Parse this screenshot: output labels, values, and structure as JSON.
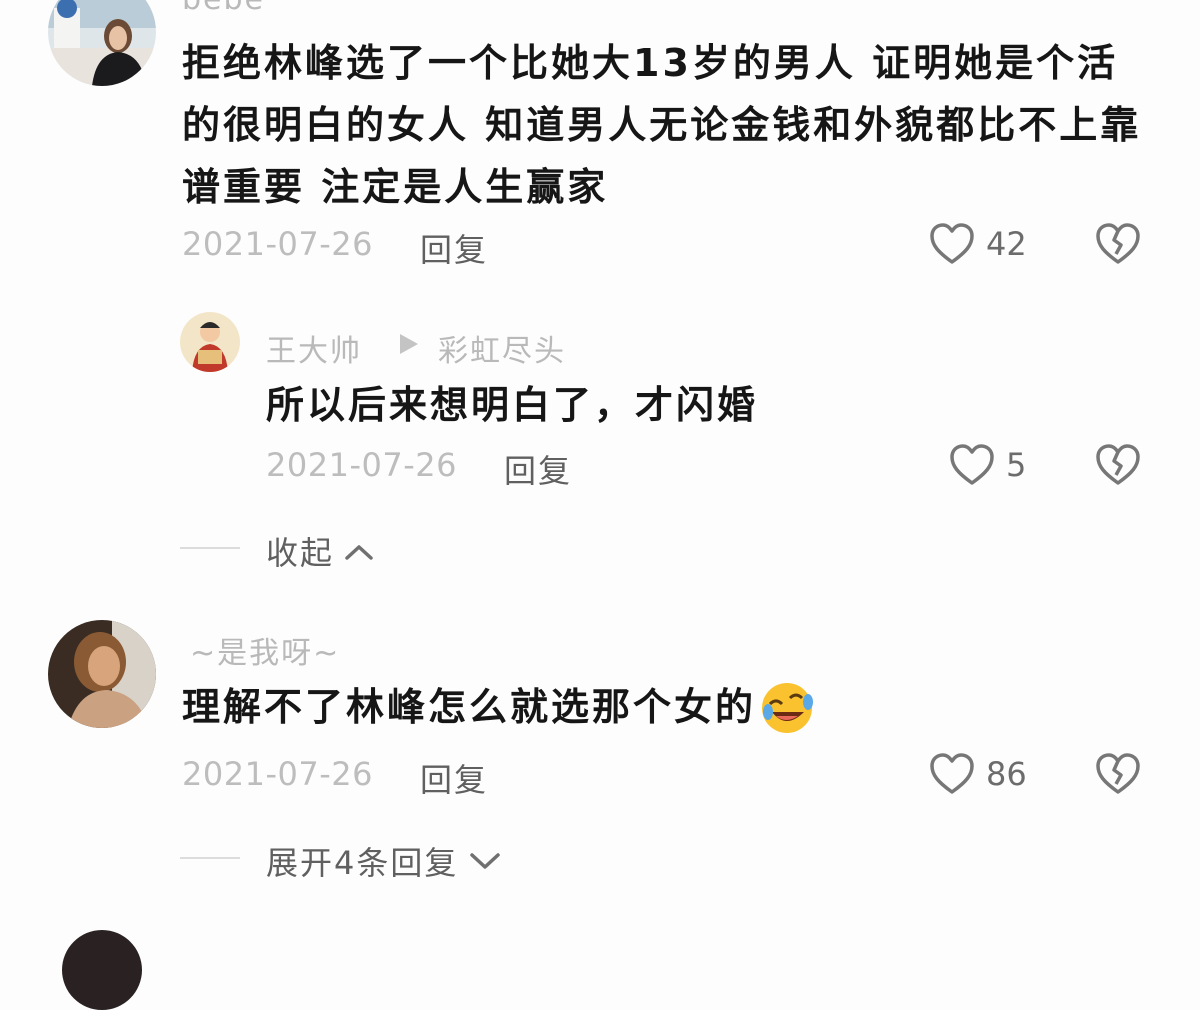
{
  "comments": [
    {
      "username": "bebe",
      "text": "拒绝林峰选了一个比她大13岁的男人 证明她是个活的很明白的女人 知道男人无论金钱和外貌都比不上靠谱重要 注定是人生赢家",
      "date": "2021-07-26",
      "reply_label": "回复",
      "likes": "42",
      "reply": {
        "username": "王大帅",
        "reply_to": "彩虹尽头",
        "text": "所以后来想明白了，才闪婚",
        "date": "2021-07-26",
        "reply_label": "回复",
        "likes": "5"
      },
      "collapse_label": "收起"
    },
    {
      "username": "~是我呀~",
      "text": "理解不了林峰怎么就选那个女的",
      "emoji": "rolling-on-floor-laughing-emoji",
      "date": "2021-07-26",
      "reply_label": "回复",
      "likes": "86",
      "expand_label": "展开4条回复"
    }
  ],
  "colors": {
    "background": "#fdfdfd",
    "username": "#b9b9b9",
    "text": "#161616",
    "meta": "#bdbdbd",
    "action": "#606060"
  },
  "icons": [
    "heart-outline-icon",
    "broken-heart-icon",
    "chevron-up-icon",
    "chevron-down-icon",
    "play-arrow-icon"
  ]
}
